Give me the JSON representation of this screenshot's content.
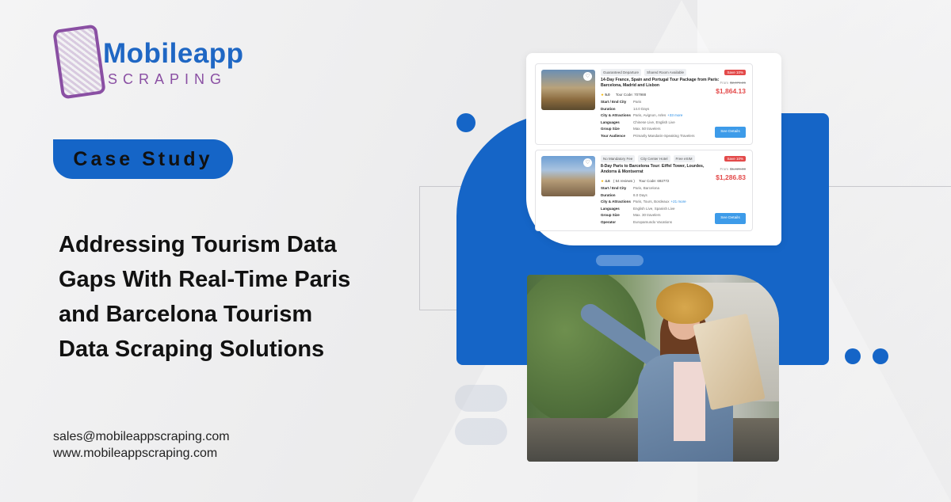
{
  "logo": {
    "word": "Mobileapp",
    "sub": "SCRAPING"
  },
  "badge": {
    "label": "Case Study"
  },
  "headline": [
    "Addressing Tourism Data",
    "Gaps With Real-Time Paris",
    "and Barcelona Tourism",
    "Data Scraping Solutions"
  ],
  "contact": {
    "email": "sales@mobileappscraping.com",
    "website": "www.mobileappscraping.com"
  },
  "colors": {
    "brand_blue": "#1565c7",
    "logo_purple": "#8a4fa3",
    "price_red": "#e34a4a",
    "button_blue": "#3d9be9"
  },
  "tours": [
    {
      "tags": [
        "Guaranteed Departure",
        "Shared Room Available"
      ],
      "sale": "Save 10%",
      "title": "14-Day France, Spain and Portugal Tour Package from Paris: Barcelona, Madrid and Lisbon",
      "from_label": "From",
      "old_price": "$2,071.26",
      "price": "$1,864.13",
      "rating": "5.0",
      "reviews": "",
      "tour_code": "Tour Code: 707988",
      "details": [
        {
          "k": "Start / End City",
          "v": "Paris",
          "more": ""
        },
        {
          "k": "Duration",
          "v": "14.0 Days",
          "more": ""
        },
        {
          "k": "City & Attractions",
          "v": "Paris, Avignon, Arles",
          "more": "+33 more"
        },
        {
          "k": "Languages",
          "v": "Chinese Live, English Live",
          "more": ""
        },
        {
          "k": "Group Size",
          "v": "Max. 50 travelers",
          "more": ""
        },
        {
          "k": "Tour Audience",
          "v": "Primarily Mandarin-Speaking Travelers",
          "more": ""
        }
      ],
      "button": "See Details"
    },
    {
      "tags": [
        "No Mandatory Fee",
        "City Center Hotel",
        "Free eSIM"
      ],
      "sale": "Save 10%",
      "title": "8-Day Paris to Barcelona Tour: Eiffel Tower, Lourdes, Andorra & Montserrat",
      "from_label": "From",
      "old_price": "$1,429.00",
      "price": "$1,286.83",
      "rating": "4.6",
      "reviews": "( 54 reviews )",
      "tour_code": "Tour Code: 692772",
      "details": [
        {
          "k": "Start / End City",
          "v": "Paris, Barcelona",
          "more": ""
        },
        {
          "k": "Duration",
          "v": "8.0 Days",
          "more": ""
        },
        {
          "k": "City & Attractions",
          "v": "Paris, Tours, Bordeaux",
          "more": "+21 more"
        },
        {
          "k": "Languages",
          "v": "English Live, Spanish Live",
          "more": ""
        },
        {
          "k": "Group Size",
          "v": "Max. 30 travelers",
          "more": ""
        },
        {
          "k": "Operator",
          "v": "Europamundo Vacations",
          "more": ""
        }
      ],
      "button": "See Details"
    }
  ]
}
